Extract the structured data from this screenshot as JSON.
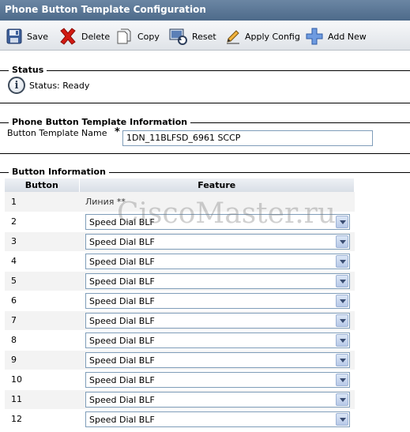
{
  "window": {
    "title": "Phone Button Template Configuration"
  },
  "toolbar": {
    "save": "Save",
    "delete": "Delete",
    "copy": "Copy",
    "reset": "Reset",
    "apply_config": "Apply Config",
    "add_new": "Add New"
  },
  "status": {
    "heading": "Status",
    "text": "Status: Ready"
  },
  "info": {
    "heading": "Phone Button Template Information",
    "name_label": "Button Template Name",
    "required_mark": "*",
    "name_value": "1DN_11BLFSD_6961 SCCP"
  },
  "buttons": {
    "heading": "Button Information",
    "col_button": "Button",
    "col_feature": "Feature",
    "rows": [
      {
        "num": "1",
        "feature": "Линия **"
      },
      {
        "num": "2",
        "feature": "Speed Dial BLF"
      },
      {
        "num": "3",
        "feature": "Speed Dial BLF"
      },
      {
        "num": "4",
        "feature": "Speed Dial BLF"
      },
      {
        "num": "5",
        "feature": "Speed Dial BLF"
      },
      {
        "num": "6",
        "feature": "Speed Dial BLF"
      },
      {
        "num": "7",
        "feature": "Speed Dial BLF"
      },
      {
        "num": "8",
        "feature": "Speed Dial BLF"
      },
      {
        "num": "9",
        "feature": "Speed Dial BLF"
      },
      {
        "num": "10",
        "feature": "Speed Dial BLF"
      },
      {
        "num": "11",
        "feature": "Speed Dial BLF"
      },
      {
        "num": "12",
        "feature": "Speed Dial BLF"
      }
    ]
  },
  "watermark": "CiscoMaster.ru",
  "icons": [
    "floppy-disk-icon",
    "red-x-icon",
    "copy-page-icon",
    "reset-icon",
    "pencil-icon",
    "blue-plus-icon",
    "info-icon",
    "chevron-down-icon"
  ]
}
